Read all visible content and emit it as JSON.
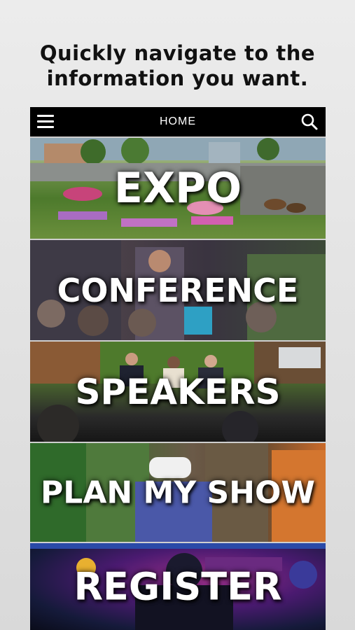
{
  "headline": {
    "line1": "Quickly navigate to the",
    "line2": "information you want."
  },
  "topbar": {
    "title": "HOME",
    "menu_icon": "hamburger-menu-icon",
    "search_icon": "search-icon"
  },
  "tiles": [
    {
      "label": "EXPO"
    },
    {
      "label": "CONFERENCE"
    },
    {
      "label": "SPEAKERS"
    },
    {
      "label": "PLAN MY SHOW"
    },
    {
      "label": "REGISTER"
    }
  ],
  "colors": {
    "background": "#e3e3e3",
    "app_bar": "#000000",
    "tile_text": "#ffffff"
  }
}
